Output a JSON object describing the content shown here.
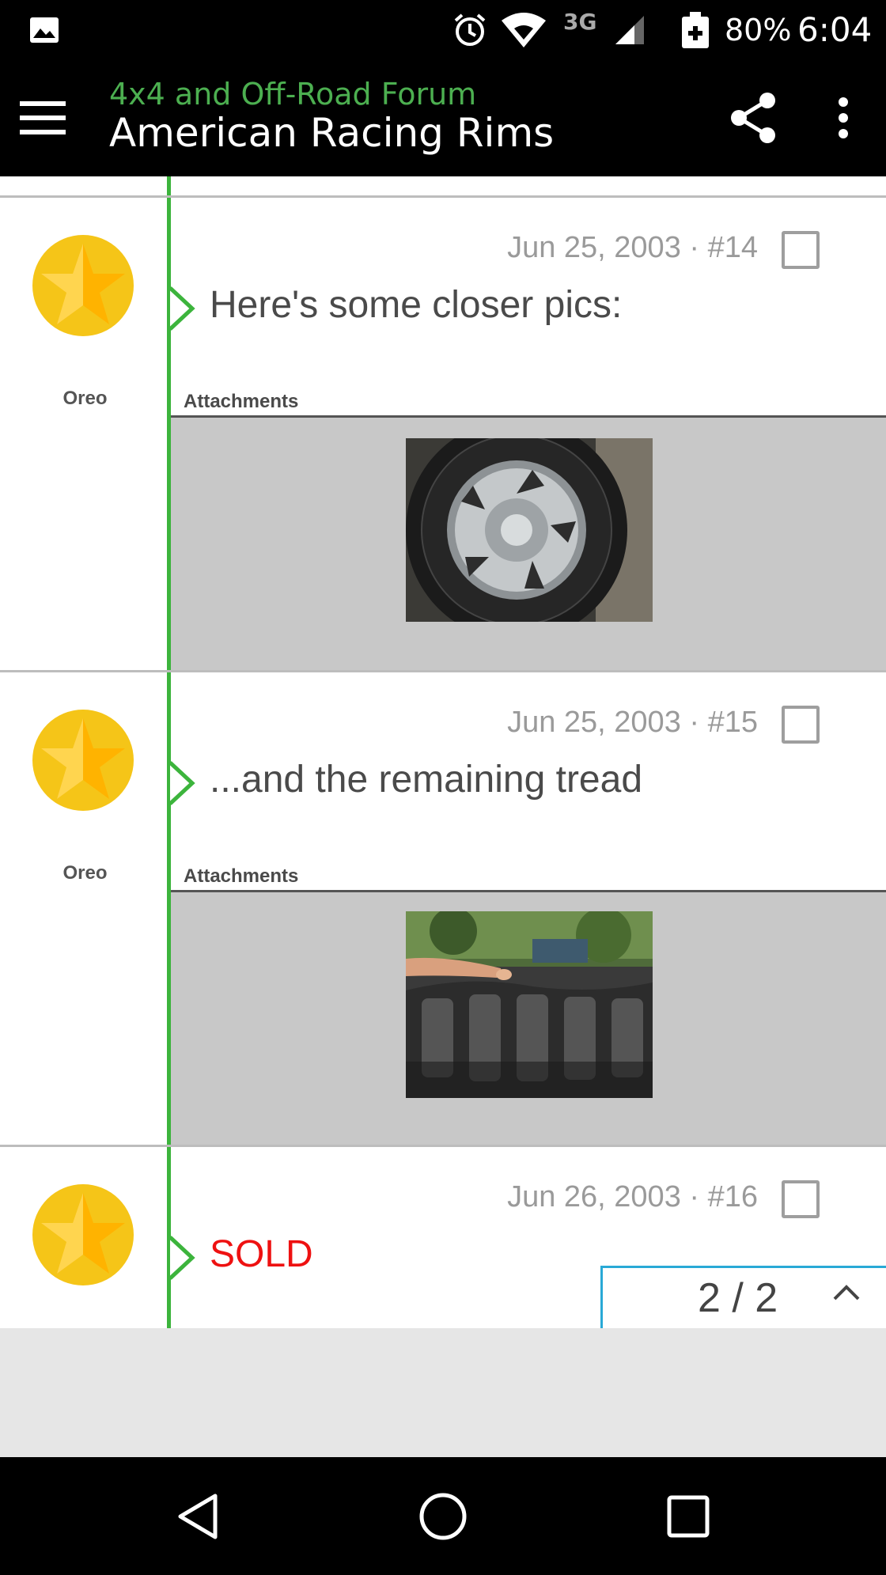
{
  "status_bar": {
    "battery_percent": "80%",
    "time": "6:04",
    "network": "3G",
    "icons": [
      "image-icon",
      "alarm-icon",
      "wifi-icon",
      "signal-icon",
      "battery-charging-icon"
    ]
  },
  "toolbar": {
    "forum_name": "4x4 and Off-Road Forum",
    "thread_title": "American Racing Rims",
    "icons": [
      "menu-icon",
      "share-icon",
      "more-vert-icon"
    ]
  },
  "posts": [
    {
      "author": "Oreo",
      "meta": "Jun 25, 2003 · #14",
      "text": "Here's some closer pics:",
      "attachments_label": "Attachments",
      "attachment": "tire-rim-photo"
    },
    {
      "author": "Oreo",
      "meta": "Jun 25, 2003 · #15",
      "text": "...and the remaining tread",
      "attachments_label": "Attachments",
      "attachment": "tire-tread-photo"
    },
    {
      "author": "",
      "meta": "Jun 26, 2003 · #16",
      "text": "SOLD"
    }
  ],
  "pager": {
    "text": "2 / 2"
  },
  "colors": {
    "accent_green": "#4caf50",
    "timeline_green": "#3cb43c",
    "sold_red": "#ee1111",
    "pager_border": "#29a9d6"
  },
  "nav_bar": {
    "icons": [
      "back-icon",
      "home-icon",
      "recents-icon"
    ]
  }
}
